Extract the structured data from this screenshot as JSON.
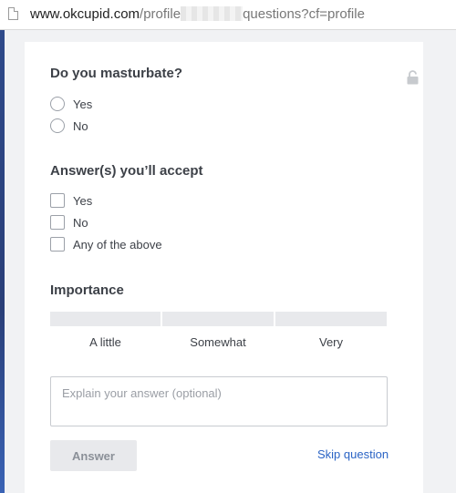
{
  "browser": {
    "url_host": "www.okcupid.com",
    "url_path_start": "/profile",
    "url_path_end": "questions?cf=profile"
  },
  "question": {
    "text": "Do you masturbate?",
    "options": [
      "Yes",
      "No"
    ]
  },
  "accept": {
    "title": "Answer(s) you’ll accept",
    "options": [
      "Yes",
      "No",
      "Any of the above"
    ]
  },
  "importance": {
    "title": "Importance",
    "levels": [
      "A little",
      "Somewhat",
      "Very"
    ]
  },
  "explain": {
    "placeholder": "Explain your answer (optional)"
  },
  "actions": {
    "answer_label": "Answer",
    "skip_label": "Skip question"
  },
  "colors": {
    "link": "#2b64c5",
    "text": "#3d4148",
    "muted_bg": "#e8e9ec"
  }
}
